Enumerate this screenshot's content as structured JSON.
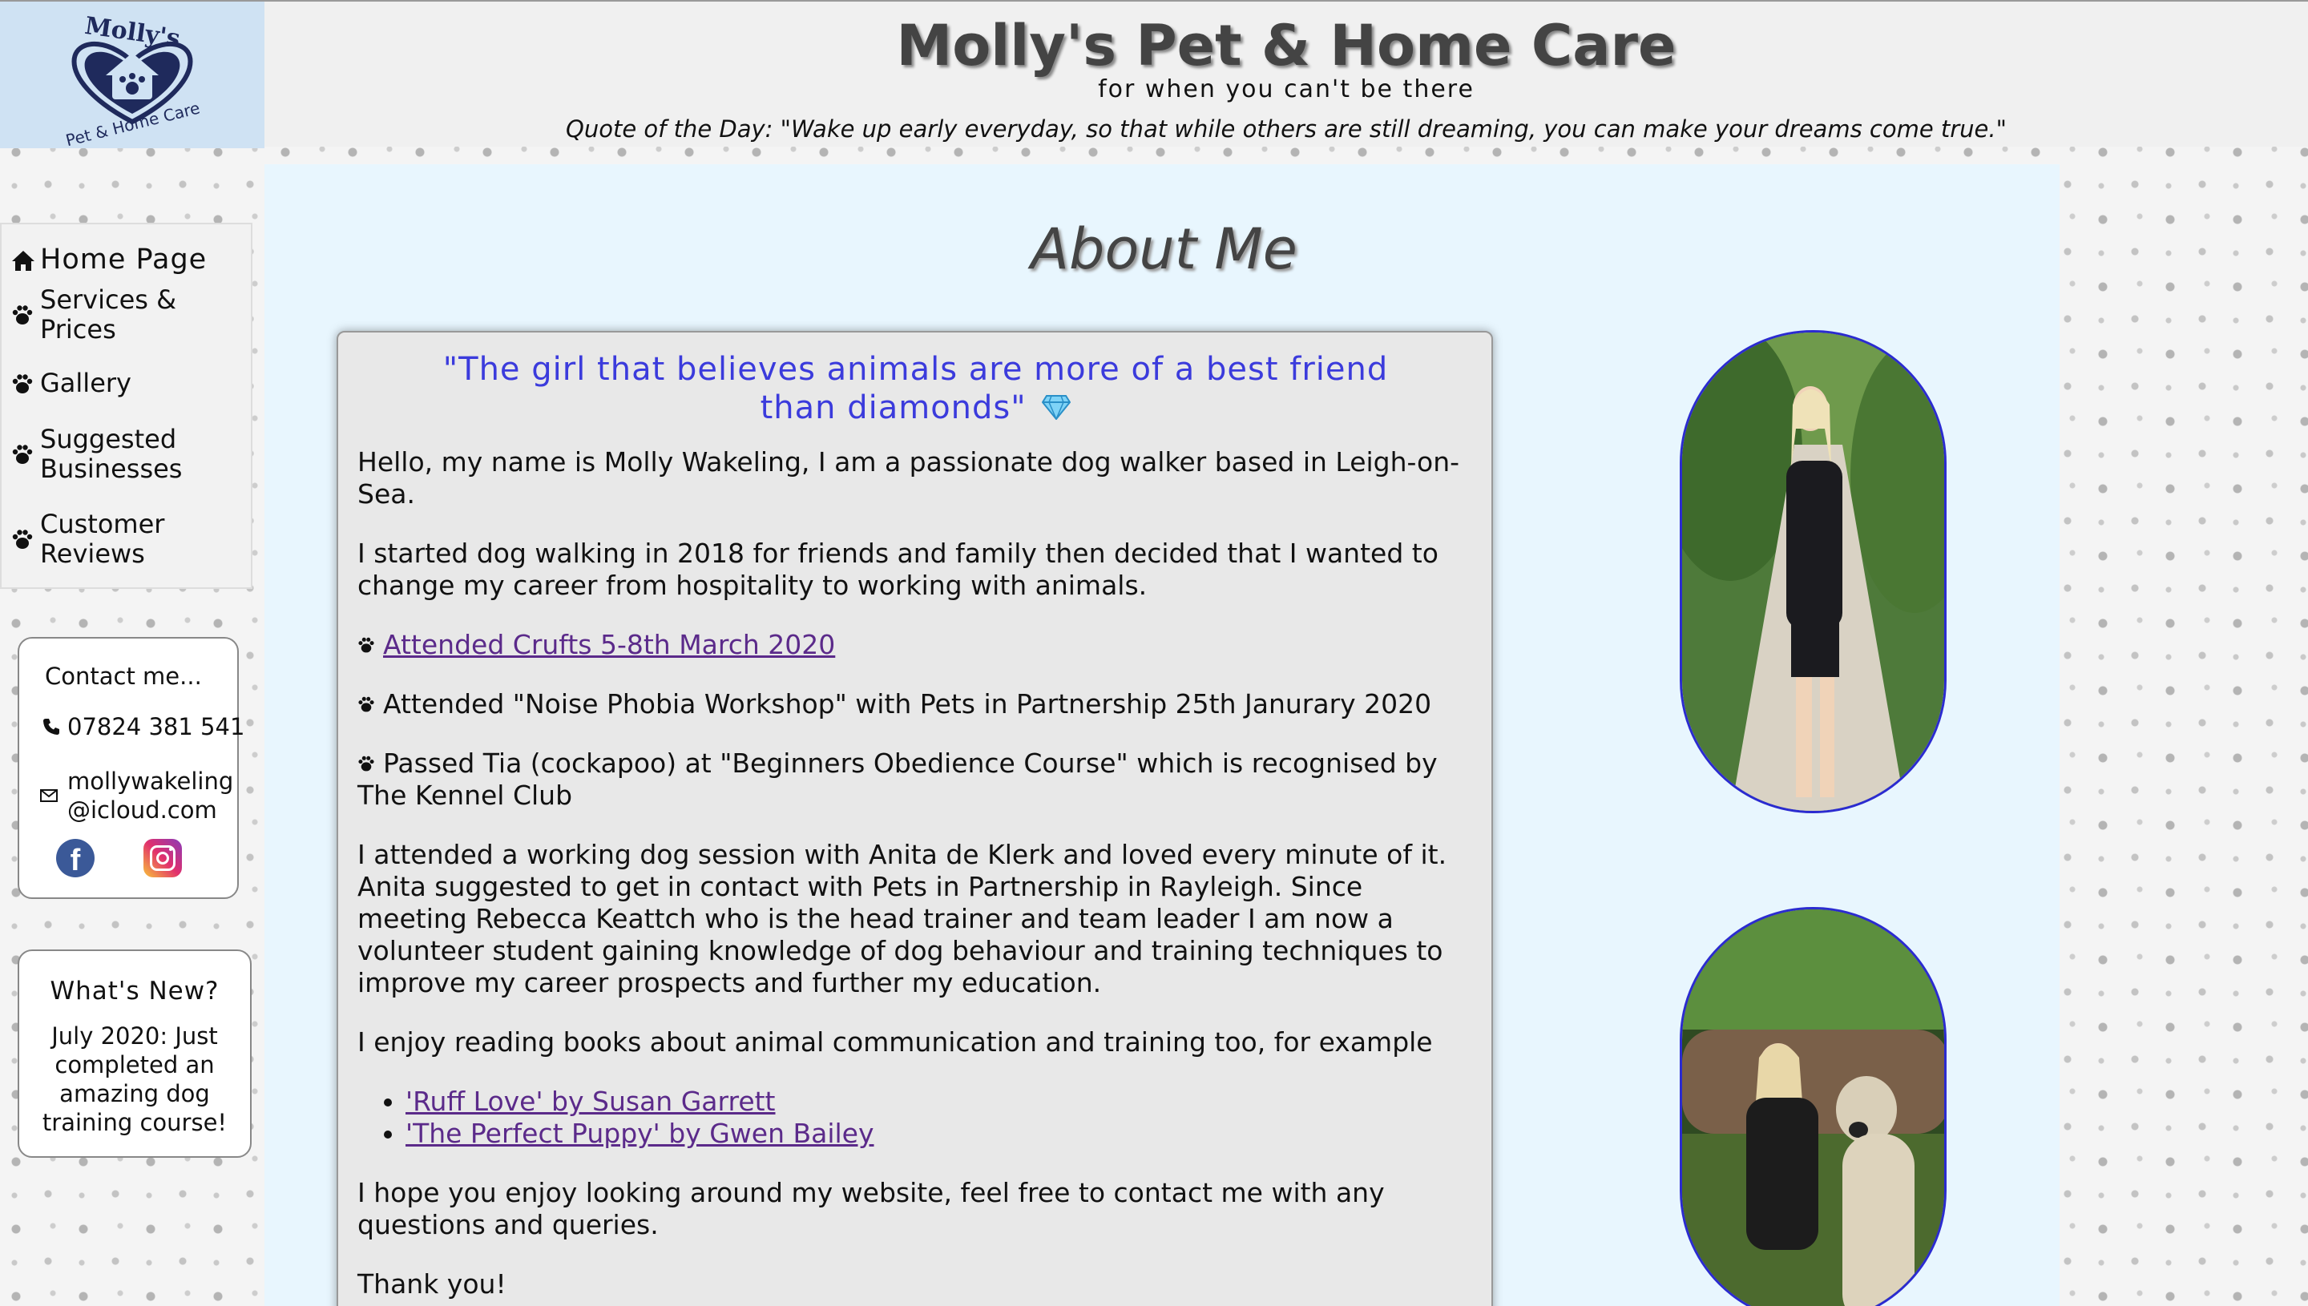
{
  "header": {
    "logo_top": "Molly's",
    "logo_bottom": "Pet & Home Care",
    "title": "Molly's Pet & Home Care",
    "tagline": "for when you can't be there",
    "quote": "Quote of the Day: \"Wake up early everyday, so that while others are still dreaming, you can make your dreams come true.\""
  },
  "nav": {
    "items": [
      {
        "label": "Home Page",
        "icon": "home-icon"
      },
      {
        "label": "Services & Prices",
        "icon": "paw-icon"
      },
      {
        "label": "Gallery",
        "icon": "paw-icon"
      },
      {
        "label": "Suggested Businesses",
        "icon": "paw-icon"
      },
      {
        "label": "Customer Reviews",
        "icon": "paw-icon"
      }
    ]
  },
  "contact": {
    "title": "Contact me...",
    "phone": "07824 381 541",
    "email_line1": "mollywakeling",
    "email_line2": "@icloud.com"
  },
  "whats_new": {
    "title": "What's New?",
    "text": "July 2020: Just completed an amazing dog training course!"
  },
  "main": {
    "heading": "About Me",
    "lead": "\"The girl that believes animals are more of a best friend than diamonds\"",
    "intro": "Hello, my name is Molly Wakeling, I am a passionate dog walker based in Leigh-on-Sea.",
    "started": "I started dog walking in 2018 for friends and family then decided that I wanted to change my career from hospitality to working with animals.",
    "crufts_link": "Attended Crufts 5-8th March 2020",
    "noise": "Attended \"Noise Phobia Workshop\" with Pets in Partnership 25th Janurary 2020",
    "tia": "Passed Tia (cockapoo) at \"Beginners Obedience Course\" which is recognised by The Kennel Club",
    "working": "I attended a working dog session with Anita de Klerk and loved every minute of it. Anita suggested to get in contact with Pets in Partnership in Rayleigh. Since meeting Rebecca Keattch who is the head trainer and team leader I am now a volunteer student gaining knowledge of dog behaviour and training techniques to improve my career prospects and further my education.",
    "books_intro": "I enjoy reading books about animal communication and training too, for example",
    "books": [
      "'Ruff Love' by Susan Garrett",
      "'The Perfect Puppy' by Gwen Bailey"
    ],
    "closing": "I hope you enjoy looking around my website, feel free to contact me with any questions and queries.",
    "thanks": "Thank you!"
  },
  "colors": {
    "lead_blue": "#3b3bdc",
    "link_purple": "#5b2a8a",
    "main_bg": "#e8f6fe",
    "photo_border": "#2b2bd0"
  }
}
